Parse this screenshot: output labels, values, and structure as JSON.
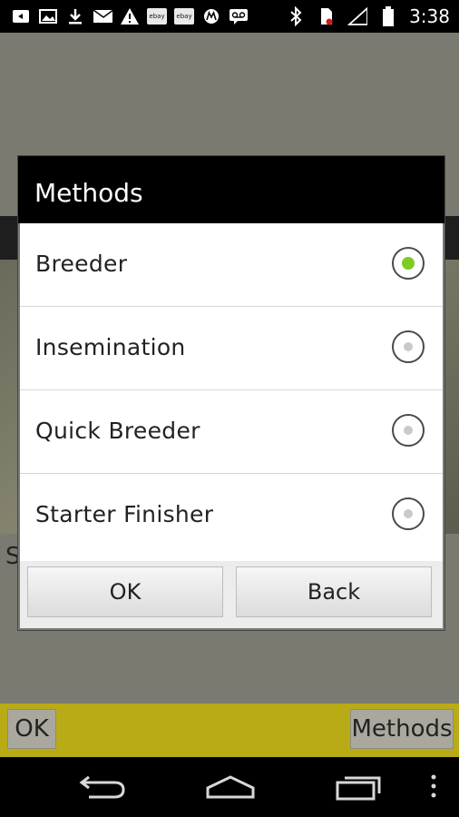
{
  "status_bar": {
    "time": "3:38",
    "left_icons": [
      "media-icon",
      "image-icon",
      "download-icon",
      "mail-icon",
      "warning-icon",
      "ebay-icon",
      "ebay-icon",
      "motorola-icon",
      "voicemail-icon"
    ],
    "ebay_label": "ebay",
    "right_icons": [
      "bluetooth-icon",
      "sim-icon",
      "signal-icon",
      "battery-icon"
    ]
  },
  "dialog": {
    "title": "Methods",
    "options": [
      {
        "label": "Breeder",
        "selected": true
      },
      {
        "label": "Insemination",
        "selected": false
      },
      {
        "label": "Quick Breeder",
        "selected": false
      },
      {
        "label": "Starter Finisher",
        "selected": false
      }
    ],
    "ok_label": "OK",
    "back_label": "Back"
  },
  "background_app": {
    "partial_text": "S",
    "ok_label": "OK",
    "methods_label": "Methods",
    "bar_color": "#b8ab16"
  },
  "nav_bar": {
    "icons": [
      "back-icon",
      "home-icon",
      "recent-apps-icon",
      "menu-icon"
    ]
  },
  "colors": {
    "selected_radio": "#7ccd1f",
    "dialog_title_bg": "#000000"
  }
}
